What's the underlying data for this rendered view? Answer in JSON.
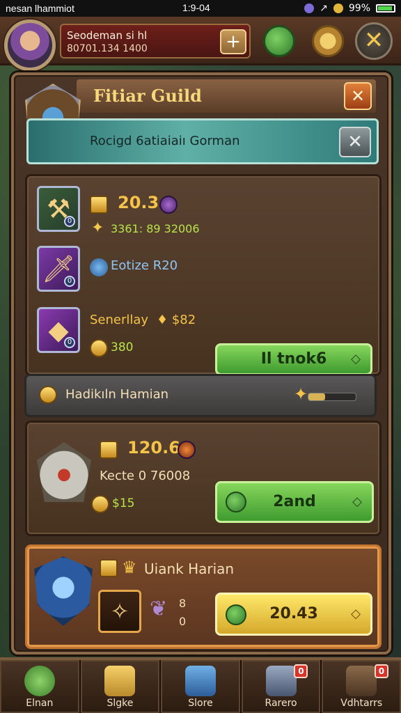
{
  "status_bar": {
    "left_text": "nesan lhammiot",
    "time": "1:9-04",
    "battery": "99%"
  },
  "top_bar": {
    "player_name": "Seodeman si hl",
    "player_stats": "80701.134 1400",
    "icons": [
      "plus-icon",
      "leaf-icon",
      "gear-icon",
      "close-icon"
    ]
  },
  "panel": {
    "title": "Fitiar Guild",
    "banner_text": "Rocigd 6atiaiaiı Gorman",
    "section1": {
      "items": [
        {
          "value": "20.3",
          "sub": "3361: 89 32006"
        },
        {
          "value": "Eotize R20"
        },
        {
          "value": "Senerllay",
          "badge": "$82",
          "sub": "380"
        }
      ],
      "button": "Il tnok6"
    },
    "progress": {
      "label": "Hadikıln Hamian",
      "fraction": 0.35
    },
    "section2": {
      "value": "120.6",
      "sub": "Kecte  0  76008",
      "coins": "$15",
      "button": "2and"
    },
    "section3": {
      "title": "Uiank Harian",
      "small_value_a": "8",
      "small_value_b": "0",
      "button": "20.43"
    }
  },
  "bottom_nav": {
    "items": [
      {
        "label": "Elnan",
        "badge": ""
      },
      {
        "label": "Slgke",
        "badge": ""
      },
      {
        "label": "Slore",
        "badge": ""
      },
      {
        "label": "Rarero",
        "badge": "0"
      },
      {
        "label": "Vdhtarrs",
        "badge": "0"
      }
    ]
  },
  "colors": {
    "accent_gold": "#f6c34a",
    "accent_green": "#86d65c",
    "panel_brown": "#4a3527",
    "banner_teal": "#5fb0a6"
  }
}
